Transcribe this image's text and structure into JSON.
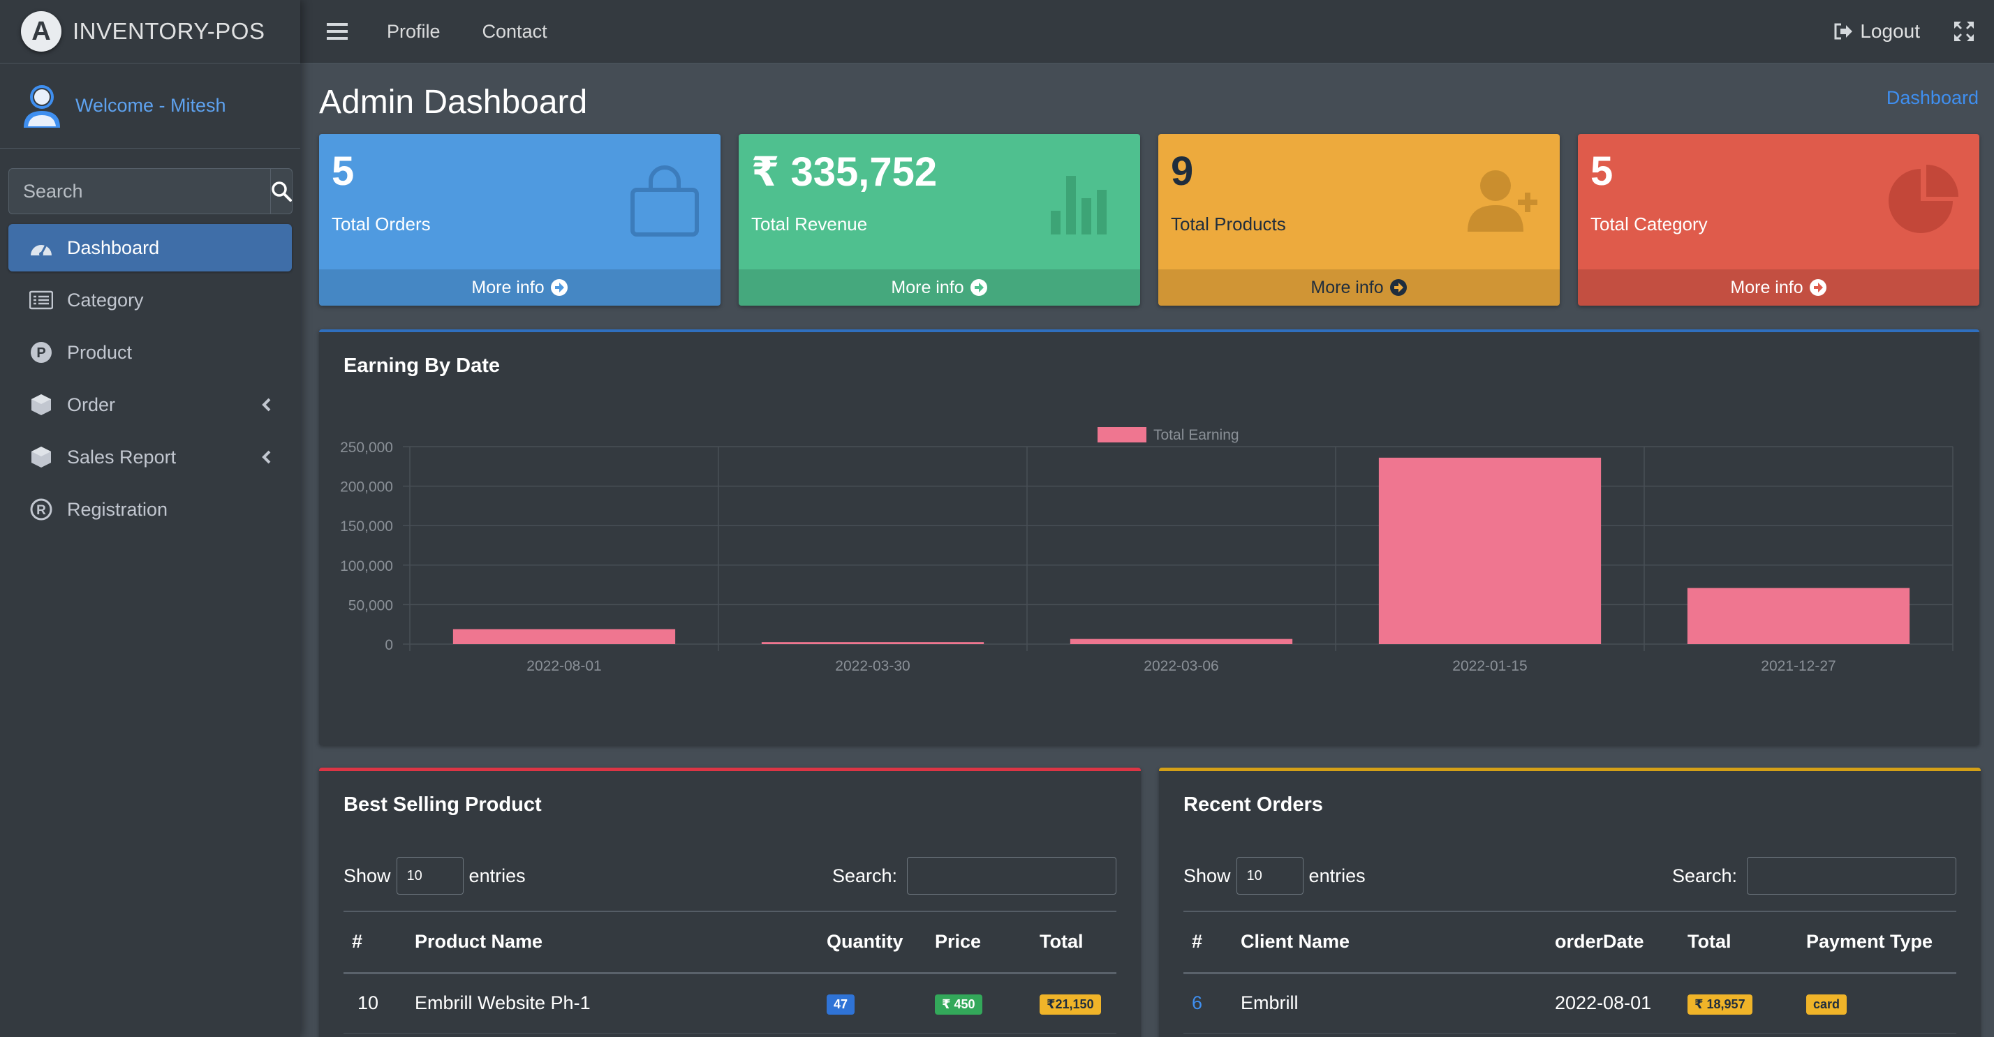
{
  "brand": {
    "logo_letter": "A",
    "name": "INVENTORY-POS"
  },
  "user": {
    "welcome": "Welcome - Mitesh"
  },
  "sidebar": {
    "search_placeholder": "Search",
    "items": [
      {
        "label": "Dashboard",
        "icon": "tachometer-icon",
        "active": true
      },
      {
        "label": "Category",
        "icon": "list-icon"
      },
      {
        "label": "Product",
        "icon": "product-p-icon"
      },
      {
        "label": "Order",
        "icon": "cube-icon",
        "has_children": true
      },
      {
        "label": "Sales Report",
        "icon": "cube-icon",
        "has_children": true
      },
      {
        "label": "Registration",
        "icon": "registered-icon"
      }
    ]
  },
  "topbar": {
    "links": [
      "Profile",
      "Contact"
    ],
    "logout": "Logout"
  },
  "page": {
    "title": "Admin Dashboard",
    "breadcrumb": "Dashboard"
  },
  "boxes": [
    {
      "value": "5",
      "label": "Total Orders",
      "footer": "More info",
      "icon": "shopping-bag-icon",
      "color": "#4f9ae0"
    },
    {
      "value": "₹ 335,752",
      "label": "Total Revenue",
      "footer": "More info",
      "icon": "bar-chart-icon",
      "color": "#4fc08f"
    },
    {
      "value": "9",
      "label": "Total Products",
      "footer": "More info",
      "icon": "user-plus-icon",
      "color": "#edaa3d"
    },
    {
      "value": "5",
      "label": "Total Category",
      "footer": "More info",
      "icon": "pie-chart-icon",
      "color": "#df5b4b"
    }
  ],
  "chart_card": {
    "title": "Earning By Date"
  },
  "chart_data": {
    "type": "bar",
    "categories": [
      "2022-08-01",
      "2022-03-30",
      "2022-03-06",
      "2022-01-15",
      "2021-12-27"
    ],
    "series": [
      {
        "name": "Total Earning",
        "values": [
          18957,
          2500,
          6500,
          236000,
          71000
        ],
        "color": "#ef7690"
      }
    ],
    "ylim": [
      0,
      250000
    ],
    "yticks": [
      "250,000",
      "200,000",
      "150,000",
      "100,000",
      "50,000",
      "0"
    ],
    "ytick_values": [
      250000,
      200000,
      150000,
      100000,
      50000,
      0
    ],
    "grid": true,
    "legend": "top-center"
  },
  "best_selling": {
    "title": "Best Selling Product",
    "show": "Show",
    "entries_value": "10",
    "entries": "entries",
    "search": "Search:",
    "columns": [
      "#",
      "Product Name",
      "Quantity",
      "Price",
      "Total"
    ],
    "rows": [
      {
        "id": "10",
        "name": "Embrill Website Ph-1",
        "quantity": "47",
        "price": "₹ 450",
        "total": "₹21,150"
      }
    ]
  },
  "recent_orders": {
    "title": "Recent Orders",
    "show": "Show",
    "entries_value": "10",
    "entries": "entries",
    "search": "Search:",
    "columns": [
      "#",
      "Client Name",
      "orderDate",
      "Total",
      "Payment Type"
    ],
    "rows": [
      {
        "id": "6",
        "client": "Embrill",
        "date": "2022-08-01",
        "total": "₹ 18,957",
        "payment": "card"
      }
    ]
  }
}
